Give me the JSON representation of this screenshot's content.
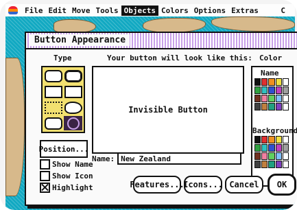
{
  "menubar": {
    "items": [
      "File",
      "Edit",
      "Move",
      "Tools",
      "Objects",
      "Colors",
      "Options",
      "Extras"
    ],
    "selected": "Objects",
    "tail": "C"
  },
  "dialog": {
    "title": "Button Appearance",
    "type_label": "Type",
    "preview_label": "Your button will look like this:",
    "color_label": "Color",
    "preview_text": "Invisible Button",
    "position_button": "Position...",
    "name_label": "Name:",
    "name_value": "New Zealand",
    "palette": {
      "name_label": "Name",
      "background_label": "Background",
      "name_colors": [
        "#111111",
        "#e03030",
        "#f09020",
        "#f0e040",
        "#ffffff",
        "#30a040",
        "#30c0c0",
        "#3050d0",
        "#c040c0",
        "#a0a0a0",
        "#703020",
        "#f080a0",
        "#60d060",
        "#80c0ff",
        "#ffffff",
        "#404040",
        "#c08040",
        "#20a080",
        "#8040c0",
        "#ffffff"
      ],
      "background_colors": [
        "#111111",
        "#e03030",
        "#f09020",
        "#f0e040",
        "#ffffff",
        "#30a040",
        "#30c0c0",
        "#3050d0",
        "#c040c0",
        "#a0a0a0",
        "#703020",
        "#f080a0",
        "#60d060",
        "#80c0ff",
        "#ffffff",
        "#404040",
        "#c08040",
        "#20a080",
        "#8040c0",
        "#ffffff"
      ]
    },
    "checkboxes": [
      {
        "label": "Show Name",
        "checked": false
      },
      {
        "label": "Show Icon",
        "checked": false
      },
      {
        "label": "Highlight",
        "checked": true
      }
    ],
    "buttons": {
      "features": "Features...",
      "icons": "Icons...",
      "cancel": "Cancel",
      "ok": "OK"
    }
  },
  "colors": {
    "accent": "#c8a0e8",
    "type_bg": "#f2e070",
    "map_water": "#12a9c2",
    "map_land": "#d7b98b"
  }
}
